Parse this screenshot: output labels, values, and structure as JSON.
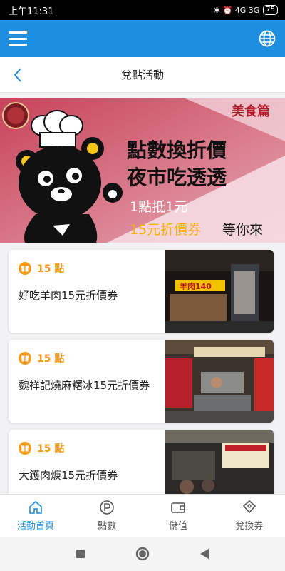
{
  "status": {
    "time": "上午11:31",
    "indicators": "✱ ⏰ 4G 3G",
    "battery": "75"
  },
  "appbar": {
    "menu_icon": "hamburger-icon",
    "globe_icon": "globe-icon",
    "color": "#1e8fe0"
  },
  "subheader": {
    "title": "兌點活動"
  },
  "banner": {
    "category": "美食篇",
    "headline1": "點數換折價",
    "headline2": "夜市吃透透",
    "line3": "1點抵1元",
    "line4_highlight": "15元折價券",
    "line4_rest": "等你來"
  },
  "cards": [
    {
      "points": "15 點",
      "name": "好吃羊肉15元折價券"
    },
    {
      "points": "15 點",
      "name": "魏祥記燒麻糬冰15元折價券"
    },
    {
      "points": "15 點",
      "name": "大鑊肉焿15元折價券"
    }
  ],
  "photos": {
    "sign1": "羊肉140"
  },
  "tabs": [
    {
      "label": "活動首頁",
      "icon": "home-icon",
      "active": true
    },
    {
      "label": "點數",
      "icon": "points-icon",
      "active": false
    },
    {
      "label": "儲值",
      "icon": "wallet-icon",
      "active": false
    },
    {
      "label": "兌換券",
      "icon": "coupon-icon",
      "active": false
    }
  ]
}
